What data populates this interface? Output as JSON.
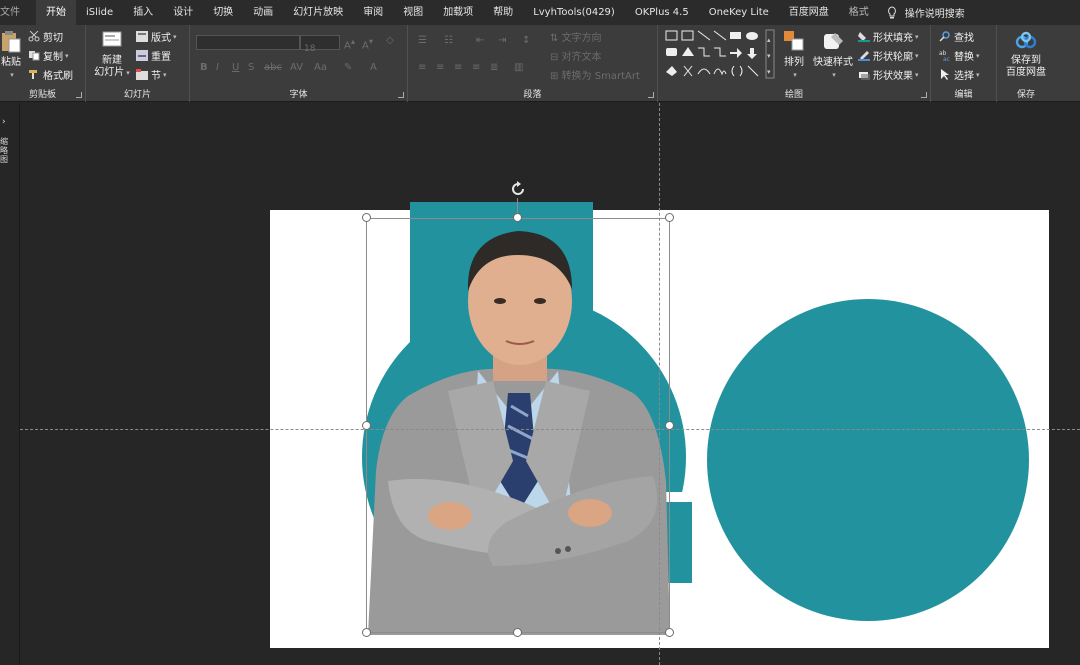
{
  "tabs": [
    {
      "label": "文件",
      "name": "tab-file",
      "style": "first"
    },
    {
      "label": "开始",
      "name": "tab-home",
      "style": "active"
    },
    {
      "label": "iSlide",
      "name": "tab-islide",
      "style": ""
    },
    {
      "label": "插入",
      "name": "tab-insert",
      "style": ""
    },
    {
      "label": "设计",
      "name": "tab-design",
      "style": ""
    },
    {
      "label": "切换",
      "name": "tab-transitions",
      "style": ""
    },
    {
      "label": "动画",
      "name": "tab-animations",
      "style": ""
    },
    {
      "label": "幻灯片放映",
      "name": "tab-slideshow",
      "style": ""
    },
    {
      "label": "审阅",
      "name": "tab-review",
      "style": ""
    },
    {
      "label": "视图",
      "name": "tab-view",
      "style": ""
    },
    {
      "label": "加载项",
      "name": "tab-addins",
      "style": ""
    },
    {
      "label": "帮助",
      "name": "tab-help",
      "style": ""
    },
    {
      "label": "LvyhTools(0429)",
      "name": "tab-lvyhtools",
      "style": ""
    },
    {
      "label": "OKPlus 4.5",
      "name": "tab-okplus",
      "style": ""
    },
    {
      "label": "OneKey Lite",
      "name": "tab-onekey",
      "style": ""
    },
    {
      "label": "百度网盘",
      "name": "tab-baidu",
      "style": ""
    },
    {
      "label": "格式",
      "name": "tab-format",
      "style": "dim"
    }
  ],
  "tell_me": "操作说明搜索",
  "clipboard": {
    "paste": "粘贴",
    "cut": "剪切",
    "copy": "复制",
    "format_painter": "格式刷",
    "label": "剪贴板"
  },
  "slides": {
    "new_slide_line1": "新建",
    "new_slide_line2": "幻灯片",
    "layout": "版式",
    "reset": "重置",
    "section": "节",
    "label": "幻灯片"
  },
  "font": {
    "size_value": "18",
    "label": "字体"
  },
  "paragraph": {
    "text_direction": "文字方向",
    "align_text": "对齐文本",
    "convert_smartart": "转换为 SmartArt",
    "label": "段落"
  },
  "drawing": {
    "arrange": "排列",
    "quick_styles": "快速样式",
    "shape_fill": "形状填充",
    "shape_outline": "形状轮廓",
    "shape_effects": "形状效果",
    "label": "绘图"
  },
  "editing": {
    "find": "查找",
    "replace": "替换",
    "select": "选择",
    "label": "编辑"
  },
  "save": {
    "line1": "保存到",
    "line2": "百度网盘",
    "label": "保存"
  },
  "side_pane": {
    "label": "缩略图"
  },
  "colors": {
    "teal": "#22929e",
    "ribbon_bg": "#3c3c3c",
    "workspace_bg": "#262626"
  }
}
